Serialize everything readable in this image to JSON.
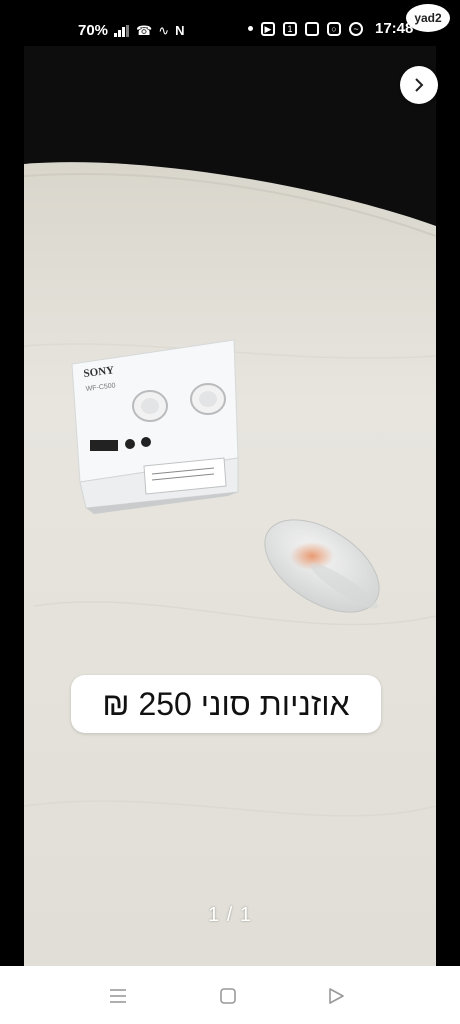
{
  "status_bar": {
    "battery": "70%",
    "time": "17:48",
    "notification_icons": [
      "dot-icon",
      "youtube-icon",
      "channel13-icon",
      "app-icon",
      "instagram-icon",
      "messenger-icon"
    ],
    "system_icons": [
      "signal-icon",
      "wifi-call-icon",
      "wifi-icon",
      "nfc-icon"
    ],
    "app_badge": "yad2"
  },
  "listing": {
    "caption": "אוזניות סוני 250 ₪",
    "page_counter": "1 / 1",
    "photo_subject": "sony-earbuds-box-and-case",
    "box_brand": "SONY",
    "box_model": "WF-C500"
  },
  "nav_bar": {
    "buttons": [
      "recent-apps-icon",
      "home-icon",
      "back-icon"
    ]
  },
  "colors": {
    "background": "#000000",
    "caption_bg": "#ffffff",
    "surface": "#e6e4dc"
  }
}
